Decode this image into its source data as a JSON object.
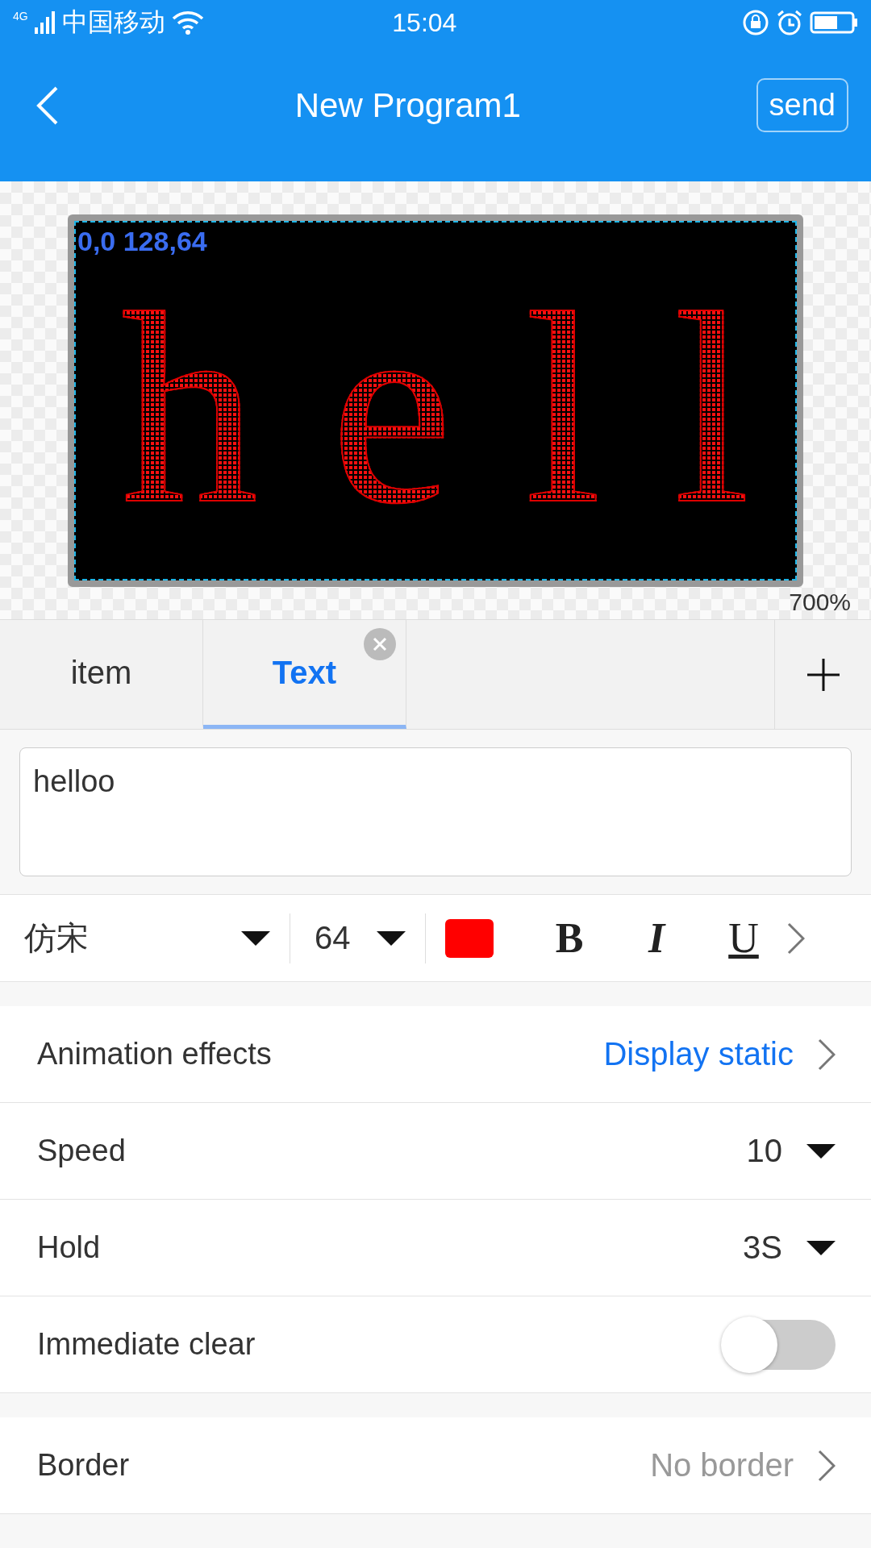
{
  "status_bar": {
    "network": "4G",
    "carrier": "中国移动",
    "time": "15:04"
  },
  "header": {
    "title": "New Program1",
    "send_label": "send"
  },
  "canvas": {
    "coords": "0,0 128,64",
    "led_text": "hell",
    "zoom": "700%"
  },
  "tabs": [
    {
      "label": "item",
      "selected": false,
      "closable": false
    },
    {
      "label": "Text",
      "selected": true,
      "closable": true
    }
  ],
  "text_input": {
    "value": "helloo"
  },
  "toolbar": {
    "font": "仿宋",
    "size": "64",
    "color": "#ff0000",
    "bold_label": "B",
    "italic_label": "I",
    "underline_label": "U"
  },
  "settings": [
    {
      "kind": "link",
      "label": "Animation effects",
      "value": "Display static",
      "accent": true
    },
    {
      "kind": "dropdown",
      "label": "Speed",
      "value": "10"
    },
    {
      "kind": "dropdown",
      "label": "Hold",
      "value": "3S"
    },
    {
      "kind": "toggle",
      "label": "Immediate clear",
      "on": false
    }
  ],
  "border_row": {
    "label": "Border",
    "value": "No border"
  }
}
